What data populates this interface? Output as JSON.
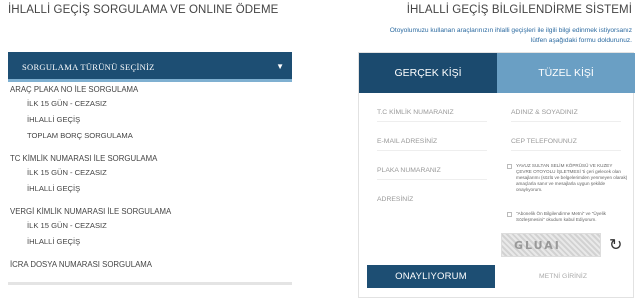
{
  "header": {
    "left_title": "İHLALLİ GEÇİŞ SORGULAMA VE ONLINE ÖDEME",
    "right_title": "İHLALLİ GEÇİŞ BİLGİLENDİRME SİSTEMİ",
    "intro_line1": "Otoyolumuzu kullanan araçlarınızın ihlalli geçişleri ile ilgili bilgi edinmek istiyorsanız",
    "intro_line2": "lütfen aşağıdaki formu doldurunuz."
  },
  "query_select": {
    "label": "SORGULAMA TÜRÜNÜ SEÇİNİZ",
    "caret": "▼"
  },
  "groups": [
    {
      "title": "ARAÇ PLAKA NO İLE SORGULAMA",
      "items": [
        "İLK 15 GÜN - CEZASIZ",
        "İHLALLİ GEÇİŞ",
        "TOPLAM BORÇ SORGULAMA"
      ]
    },
    {
      "title": "TC KİMLİK NUMARASI İLE SORGULAMA",
      "items": [
        "İLK 15 GÜN - CEZASIZ",
        "İHLALLİ GEÇİŞ"
      ]
    },
    {
      "title": "VERGİ KİMLİK NUMARASI İLE SORGULAMA",
      "items": [
        "İLK 15 GÜN - CEZASIZ",
        "İHLALLİ GEÇİŞ"
      ]
    },
    {
      "title": "İCRA DOSYA NUMARASI SORGULAMA",
      "items": []
    }
  ],
  "form": {
    "tab_real": "GERÇEK KİŞİ",
    "tab_legal": "TÜZEL KİŞİ",
    "tc_placeholder": "T.C KİMLİK NUMARANIZ",
    "name_placeholder": "ADINIZ & SOYADINIZ",
    "email_placeholder": "E-MAIL ADRESİNİZ",
    "phone_placeholder": "CEP TELEFONUNUZ",
    "plate_placeholder": "PLAKA NUMARANIZ",
    "address_placeholder": "ADRESİNİZ",
    "consent1": "YAVUZ SULTAN SELİM KÖPRÜSÜ VE KUZEY ÇEVRE OTOYOLU İŞLETMESİ 'ti çeri gelecek olan mesajlarımı (sözlü ve belgelerimden yenmeyen olarak) amaçlarla sanır ve mesajlarla uygun şekilde onaylıyorum.",
    "consent2": "\"Abonelik Ön Bilgilendirme Metni\" ve \"Üyelik Sözleşmesini\" okudum kabul Ediyorum.",
    "captcha_text": "GLUAI",
    "submit_label": "ONAYLIYORUM",
    "code_placeholder": "METNİ GİRİNİZ"
  }
}
